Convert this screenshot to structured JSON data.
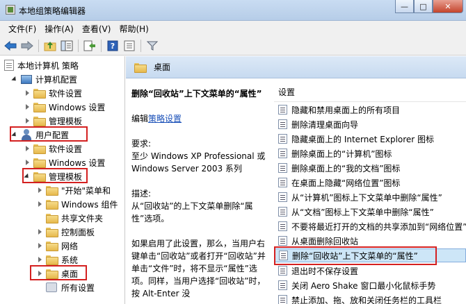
{
  "window": {
    "title": "本地组策略编辑器",
    "minimize": "—",
    "maximize": "□",
    "close": "✕"
  },
  "menu": [
    "文件(F)",
    "操作(A)",
    "查看(V)",
    "帮助(H)"
  ],
  "toolbar": {
    "icons": [
      "back-arrow-icon",
      "forward-arrow-icon",
      "up-folder-icon",
      "show-hide-tree-icon",
      "export-list-icon",
      "help-icon",
      "properties-icon",
      "filter-icon"
    ]
  },
  "tree": {
    "root": "本地计算机 策略",
    "computer_config": "计算机配置",
    "cc_software": "软件设置",
    "cc_windows": "Windows 设置",
    "cc_admin": "管理模板",
    "user_config": "用户配置",
    "uc_software": "软件设置",
    "uc_windows": "Windows 设置",
    "uc_admin": "管理模板",
    "admin_children": [
      "\"开始\"菜单和",
      "Windows 组件",
      "共享文件夹",
      "控制面板",
      "网络",
      "系统",
      "桌面"
    ],
    "all_settings": "所有设置"
  },
  "category": {
    "title": "桌面"
  },
  "description": {
    "title": "删除“回收站”上下文菜单的“属性”",
    "edit_prefix": "编辑",
    "edit_link": "策略设置",
    "requirements_label": "要求:",
    "requirements_text": "至少 Windows XP Professional 或 Windows Server 2003 系列",
    "desc_label": "描述:",
    "desc_text": "从“回收站”的上下文菜单删除“属性”选项。",
    "detail_text": "如果启用了此设置，那么，当用户右键单击“回收站”或者打开“回收站”并单击“文件”时，将不显示“属性”选项。同样，当用户选择“回收站”时，按 Alt-Enter 没"
  },
  "settings": {
    "header": "设置",
    "items": [
      "隐藏和禁用桌面上的所有项目",
      "删除清理桌面向导",
      "隐藏桌面上的 Internet Explorer 图标",
      "删除桌面上的“计算机”图标",
      "删除桌面上的“我的文档”图标",
      "在桌面上隐藏“网络位置”图标",
      "从“计算机”图标上下文菜单中删除“属性”",
      "从“文档”图标上下文菜单中删除“属性”",
      "不要将最近打开的文档的共享添加到“网络位置”",
      "从桌面删除回收站",
      "删除“回收站”上下文菜单的“属性”",
      "退出时不保存设置",
      "关闭 Aero Shake 窗口最小化鼠标手势",
      "禁止添加、拖、放和关闭任务栏的工具栏"
    ],
    "selected_index": 10
  },
  "colors": {
    "highlight": "#d42020",
    "selection": "#cde6f7",
    "link": "#1a50b8"
  }
}
